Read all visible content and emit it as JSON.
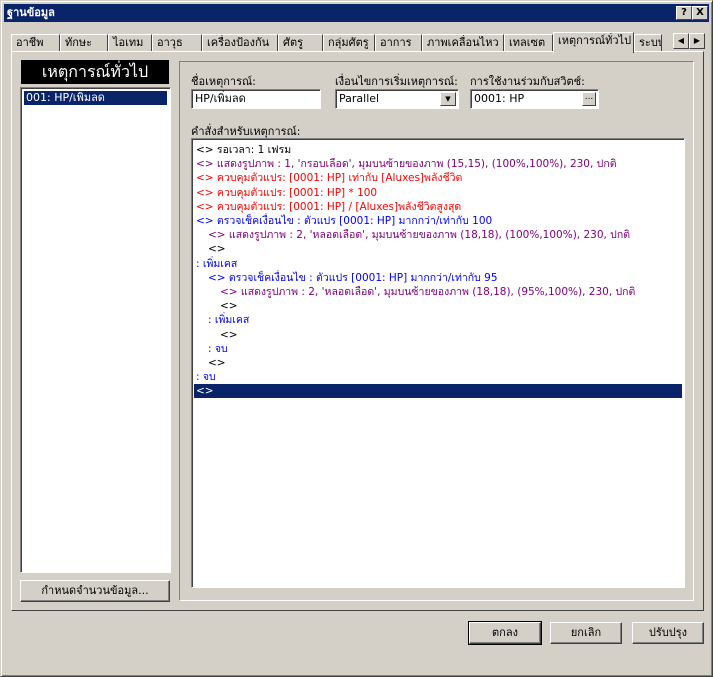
{
  "window": {
    "title": "ฐานข้อมูล"
  },
  "titlebar_buttons": {
    "help": "?",
    "close": "X"
  },
  "tabs": [
    "อาชีพ",
    "ทักษะ",
    "ไอเทม",
    "อาวุธ",
    "เครื่องป้องกัน",
    "ศัตรู",
    "กลุ่มศัตรู",
    "อาการ",
    "ภาพเคลื่อนไหว",
    "เทลเซต",
    "เหตุการณ์ทั่วไป",
    "ระบบ"
  ],
  "active_tab": "เหตุการณ์ทั่วไป",
  "left_panel": {
    "title": "เหตุการณ์ทั่วไป",
    "items": [
      "001: HP/เพิ่มลด"
    ],
    "set_count_button": "กำหนดจำนวนข้อมูล..."
  },
  "event": {
    "name_label": "ชื่อเหตุการณ์:",
    "name_value": "HP/เพิ่มลด",
    "condition_label": "เงื่อนไขการเริ่มเหตุการณ์:",
    "condition_value": "Parallel",
    "switch_label": "การใช้งานร่วมกับสวิตช์:",
    "switch_value": "0001: HP",
    "switch_button": "..."
  },
  "commands": {
    "label": "คำสั่งสำหรับเหตุการณ์:",
    "lines": [
      {
        "text": "<> รอเวลา: 1 เฟรม",
        "indent": 0,
        "color": "#000000"
      },
      {
        "text": "<> แสดงรูปภาพ : 1, 'กรอบเลือด', มุมบนซ้ายของภาพ (15,15), (100%,100%), 230, ปกติ",
        "indent": 0,
        "color": "#800080"
      },
      {
        "text": "<> ควบคุมตัวแปร: [0001: HP] เท่ากับ [Aluxes]พลังชีวิต",
        "indent": 0,
        "color": "#ff0000"
      },
      {
        "text": "<> ควบคุมตัวแปร: [0001: HP] * 100",
        "indent": 0,
        "color": "#ff0000"
      },
      {
        "text": "<> ควบคุมตัวแปร: [0001: HP] / [Aluxes]พลังชีวิตสูงสุด",
        "indent": 0,
        "color": "#ff0000"
      },
      {
        "text": "<> ตรวจเช็คเงื่อนไข : ตัวแปร [0001: HP] มากกว่า/เท่ากับ 100",
        "indent": 0,
        "color": "#0000ff"
      },
      {
        "text": "<> แสดงรูปภาพ : 2, 'หลอดเลือด', มุมบนซ้ายของภาพ (18,18), (100%,100%), 230, ปกติ",
        "indent": 1,
        "color": "#800080"
      },
      {
        "text": "<>",
        "indent": 1,
        "color": "#000000"
      },
      {
        "text": ": เพิ่มเคส",
        "indent": 0,
        "color": "#0000ff"
      },
      {
        "text": "<> ตรวจเช็คเงื่อนไข : ตัวแปร [0001: HP] มากกว่า/เท่ากับ 95",
        "indent": 1,
        "color": "#0000ff"
      },
      {
        "text": "<> แสดงรูปภาพ : 2, 'หลอดเลือด', มุมบนซ้ายของภาพ (18,18), (95%,100%), 230, ปกติ",
        "indent": 2,
        "color": "#800080"
      },
      {
        "text": "<>",
        "indent": 2,
        "color": "#000000"
      },
      {
        "text": ": เพิ่มเคส",
        "indent": 1,
        "color": "#0000ff"
      },
      {
        "text": "<>",
        "indent": 2,
        "color": "#000000"
      },
      {
        "text": ": จบ",
        "indent": 1,
        "color": "#0000ff"
      },
      {
        "text": "<>",
        "indent": 1,
        "color": "#000000"
      },
      {
        "text": ": จบ",
        "indent": 0,
        "color": "#0000ff"
      },
      {
        "text": "<>",
        "indent": 0,
        "color": "#ffffff",
        "selected": true
      }
    ]
  },
  "footer": {
    "ok": "ตกลง",
    "cancel": "ยกเลิก",
    "apply": "ปรับปรุง"
  }
}
